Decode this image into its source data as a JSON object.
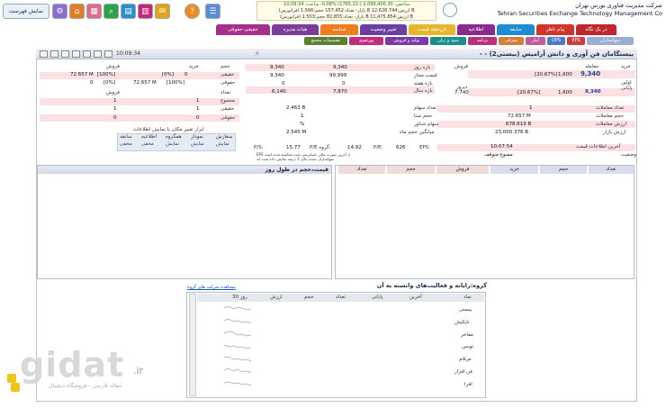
{
  "topbar": {
    "show_list": "نمایش فهرست",
    "index_lines": [
      "شاخص: 2,098,406.30 (-1765.22) %0.08- ساعت: 10:09:34",
      "(فرابورس) بازار- تعداد:157,452 حجم:1.566 B ارزش:12,626.744 B",
      "(فرابورس) بازار- تعداد:82,855 حجم:1.503 B ارزش:11,475.854 B"
    ],
    "company_line1": "شرکت مدیریت فناوری بورس تهران",
    "company_line2": "Tehran Securities Exchange Technology Management Co"
  },
  "tabs": [
    {
      "label": "در یک نگاه",
      "color": "#c0282f"
    },
    {
      "label": "پیام ناظر",
      "color": "#d2342a"
    },
    {
      "label": "سابقه",
      "color": "#1f8bd0"
    },
    {
      "label": "اطلاعیه",
      "color": "#8b2a8d"
    },
    {
      "label": "تاریخچه قیمت",
      "color": "#e5b82c"
    },
    {
      "label": "تغییر وضعیت",
      "color": "#6a3fa0"
    },
    {
      "label": "شناسه",
      "color": "#ee7d1f"
    },
    {
      "label": "هیات مدیره",
      "color": "#7a3d98"
    },
    {
      "label": "حقیقی-حقوقی",
      "color": "#a62f8a"
    }
  ],
  "subtabs": [
    {
      "label": "سهامداران",
      "color": "#9aaed3"
    },
    {
      "label": "EPS",
      "color": "#d03c3c"
    },
    {
      "label": "DPS",
      "color": "#4d7ac2"
    },
    {
      "label": "آمار",
      "color": "#c05a9d"
    },
    {
      "label": "معرفی",
      "color": "#d47d37"
    },
    {
      "label": "برنامه",
      "color": "#b8317d"
    },
    {
      "label": "سود و زیان",
      "color": "#1a8f8a"
    },
    {
      "label": "تولید و فروش",
      "color": "#7b3aa8"
    },
    {
      "label": "پورتفوی",
      "color": "#c02d80"
    },
    {
      "label": "تصمیمات مجمع",
      "color": "#5b7f2f"
    }
  ],
  "main": {
    "title": "بیستگامان فن آوری و دانش آرامیس (بیستی2) - -",
    "clock": "10:09:34"
  },
  "left_block": {
    "buy_label": "خرید",
    "sell_label": "فروش",
    "txn_label": "معامله",
    "last_label": "اولین",
    "close_label": "پایانی",
    "yesterday_label": "دیروز",
    "last_price": "9,340",
    "last_change": "1,600",
    "last_pct": "[20.67%]",
    "close_price": "9,340",
    "close_change": "1,600",
    "close_pct": "[20.67%]",
    "yesterday": "7,740",
    "rows": [
      {
        "label": "تعداد معاملات",
        "value": "1"
      },
      {
        "label": "حجم معاملات",
        "value": "72.657 M"
      },
      {
        "label": "ارزش معاملات",
        "value": "678.619 B"
      },
      {
        "label": "ارزش بازار",
        "value": "23,000.376 B"
      }
    ],
    "last_info_label": "آخرین اطلاعات قیمت",
    "last_info_value": "10:07:54",
    "status_label": "وضعیت",
    "status_value": "ممنوع-متوقف"
  },
  "range_block": {
    "rows": [
      {
        "label": "بازه روز",
        "v1": "9,340",
        "v2": "9,340"
      },
      {
        "label": "قیمت مجاز",
        "v1": "99,999",
        "v2": "9,340"
      },
      {
        "label": "بازه هفته",
        "v1": "0",
        "v2": "0"
      },
      {
        "label": "بازه سال",
        "v1": "7,870",
        "v2": "6,140"
      }
    ],
    "info": [
      {
        "label": "تعداد سهام",
        "value": "2.463 B"
      },
      {
        "label": "حجم مبنا",
        "value": "1"
      },
      {
        "label": "سهام شناور",
        "value": "%"
      },
      {
        "label": "میانگین حجم ماه",
        "value": "2.545 M"
      }
    ],
    "eps_label": "EPS:",
    "eps_value": "626",
    "pe_label": "P/E:",
    "pe_value": "14.92",
    "gpe_label": "P/E گروه:",
    "gpe_value": "15.77",
    "ps_label": "P/S:",
    "ps_value": "",
    "notes": [
      "EPS از آخرین صورت مالی حسابرسی شده محاسبه شده است",
      "سهامداران عمده بالای 1 درصد نمایش داده شده اند"
    ]
  },
  "client_block": {
    "headers": [
      "حجم",
      "خرید",
      "فروش"
    ],
    "rows": [
      {
        "label": "حقیقی",
        "buy": "72.657 M",
        "buy_pct": "[100%]",
        "sell": "0",
        "sell_pct": "[0%]"
      },
      {
        "label": "حقوقی",
        "buy": "0",
        "buy_pct": "[0%]",
        "sell": "72.657 M",
        "sell_pct": "[100%]"
      }
    ],
    "count_label": "تعداد",
    "count_buy": "1",
    "count_sell": "",
    "sub_rows": [
      {
        "label": "مجموع",
        "v1": "1",
        "v2": "1"
      },
      {
        "label": "حقیقی",
        "v1": "1",
        "v2": "1"
      },
      {
        "label": "حقوقی",
        "v1": "0",
        "v2": "0"
      }
    ],
    "tools_label": "ابزار تغییر مکان یا نمایش اطلاعات",
    "tools": [
      {
        "top": "سفارش",
        "bottom": "نمایش"
      },
      {
        "top": "نمودار",
        "bottom": "نمایش"
      },
      {
        "top": "همگروه",
        "bottom": "نمایش"
      },
      {
        "top": "اطلاعیه",
        "bottom": "مخفی"
      },
      {
        "top": "سابقه",
        "bottom": "مخفی"
      }
    ]
  },
  "orderbook": {
    "headers": [
      "تعداد",
      "حجم",
      "خرید",
      "فروش",
      "حجم",
      "تعداد"
    ]
  },
  "price_volume": {
    "title": "قیمت،حجم در طول روز"
  },
  "group": {
    "title": "گروه:رایانه و فعالیت‌های وابسته به آن",
    "link": "مشاهده شرکت های گروه",
    "headers": [
      "نماد",
      "آخرین",
      "پایانی",
      "تعداد",
      "حجم",
      "ارزش",
      "30 روز"
    ],
    "rows": [
      "بیستی",
      "تاپکیش",
      "مفاخر",
      "توسن",
      "مرقام",
      "فن افزار",
      "افرا"
    ]
  },
  "watermark": {
    "brand": "gidat",
    "suffix": ".ir",
    "tagline": "مقاله فارسی - فروشگاه دیجیتال"
  }
}
